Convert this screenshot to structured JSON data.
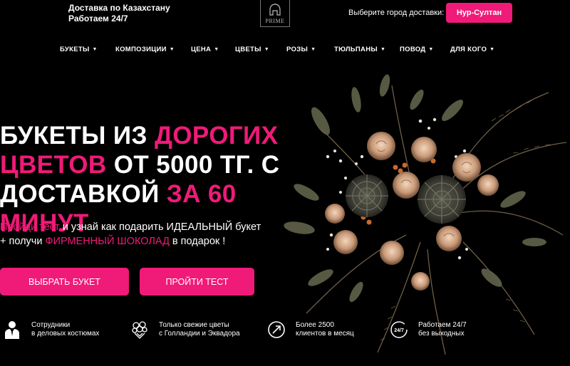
{
  "header": {
    "delivery_line1": "Доставка по Казахстану",
    "delivery_line2": "Работаем 24/7",
    "logo_text": "PRIME",
    "city_label": "Выберите город доставки:",
    "city_value": "Нур-Султан"
  },
  "nav": {
    "items": [
      {
        "label": "БУКЕТЫ"
      },
      {
        "label": "КОМПОЗИЦИИ"
      },
      {
        "label": "ЦЕНА"
      },
      {
        "label": "ЦВЕТЫ"
      },
      {
        "label": "РОЗЫ"
      },
      {
        "label": "ТЮЛЬПАНЫ"
      },
      {
        "label": "ПОВОД"
      },
      {
        "label": "ДЛЯ КОГО"
      }
    ]
  },
  "hero": {
    "title_p1": "БУКЕТЫ ИЗ ",
    "title_p2": "ДОРОГИХ",
    "title_p3": "ЦВЕТОВ",
    "title_p4": " ОТ 5000 ТГ. С",
    "title_p5": "ДОСТАВКОЙ ",
    "title_p6": "ЗА 60 МИНУТ",
    "sub_p1": "Пройди тест",
    "sub_p2": " и узнай как подарить ИДЕАЛЬНЫЙ букет",
    "sub_p3": "+ получи ",
    "sub_p4": "ФИРМЕННЫЙ ШОКОЛАД",
    "sub_p5": " в подарок !",
    "btn_choose": "ВЫБРАТЬ БУКЕТ",
    "btn_test": "ПРОЙТИ ТЕСТ"
  },
  "features": [
    {
      "icon": "suit-person-icon",
      "line1": "Сотрудники",
      "line2": "в деловых костюмах"
    },
    {
      "icon": "flowers-icon",
      "line1": "Только свежие цветы",
      "line2": "с Голландии и Эквадора"
    },
    {
      "icon": "arrow-circle-icon",
      "line1": "Более 2500",
      "line2": "клиентов в месяц"
    },
    {
      "icon": "clock-24-7-icon",
      "badge": "24/7",
      "line1": "Работаем 24/7",
      "line2": "без выходных"
    }
  ],
  "colors": {
    "accent": "#f01a78",
    "background": "#000000"
  }
}
